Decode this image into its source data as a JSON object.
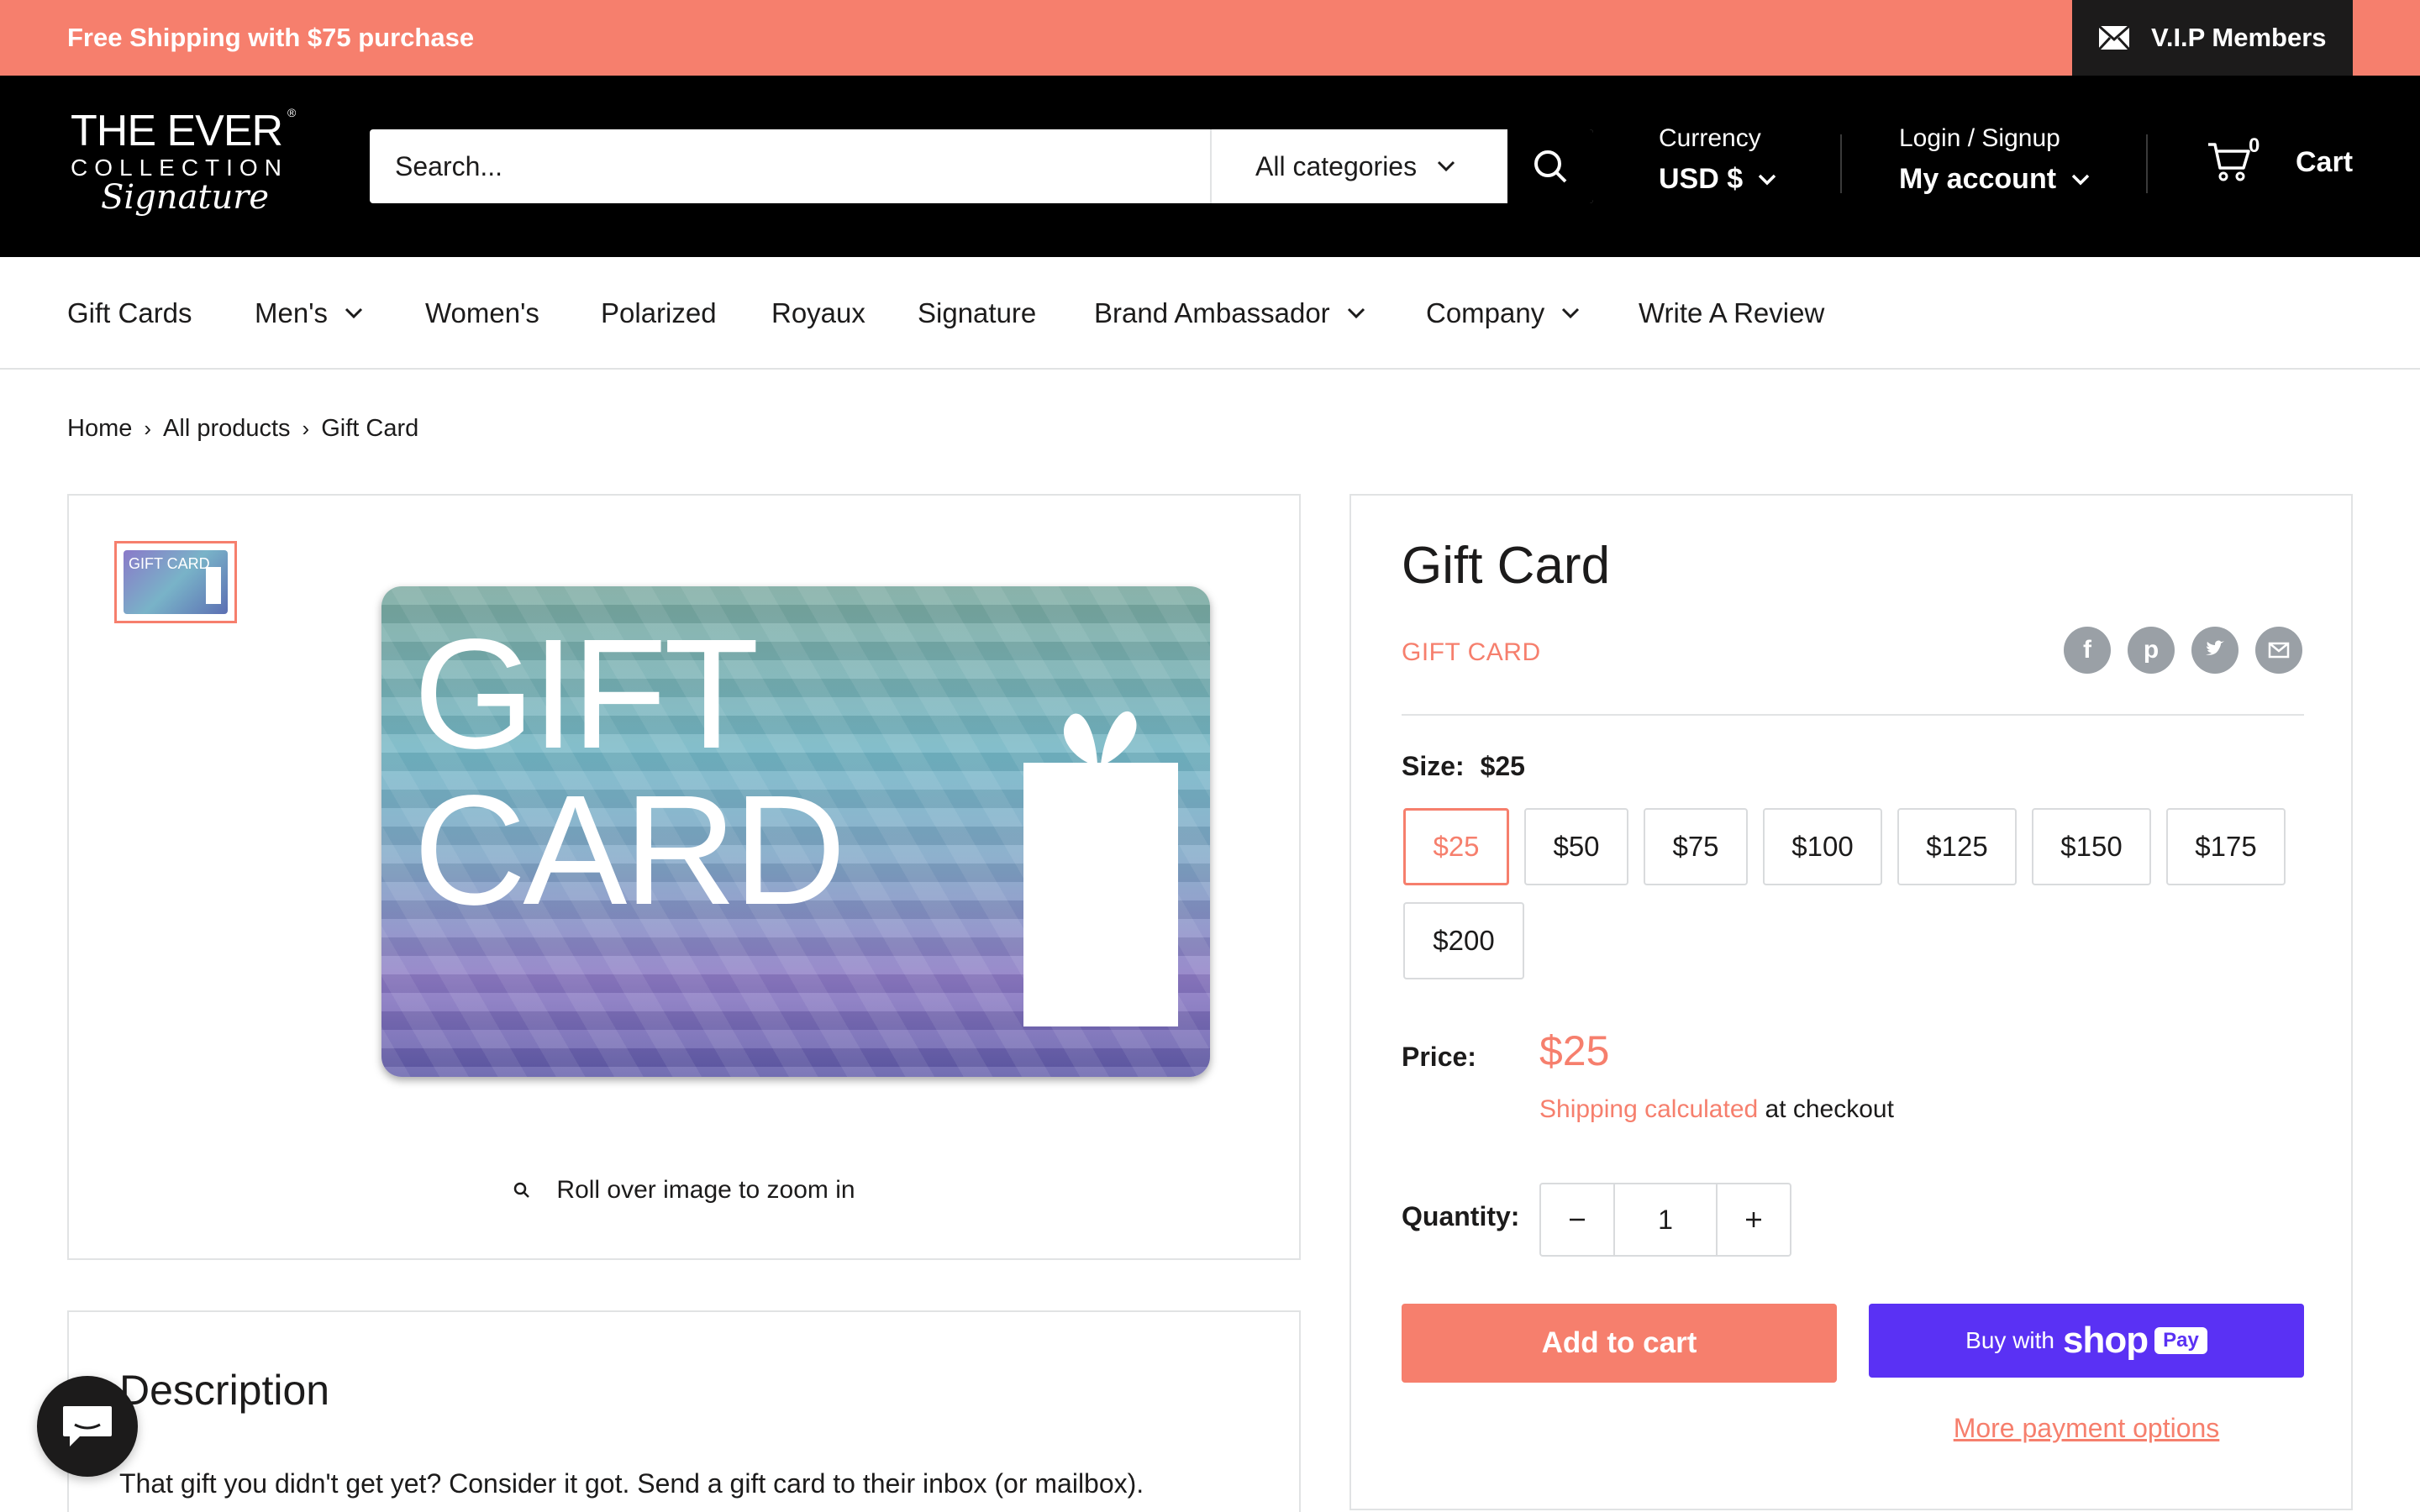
{
  "announcement": {
    "text": "Free Shipping with $75 purchase",
    "vip_label": "V.I.P Members",
    "background": "#f67f6d"
  },
  "header": {
    "logo": {
      "line1": "THE EVER",
      "line2": "COLLECTION",
      "script": "Signature",
      "mark": "®"
    },
    "search": {
      "placeholder": "Search...",
      "category": "All categories"
    },
    "currency": {
      "label": "Currency",
      "value": "USD $"
    },
    "account": {
      "label": "Login / Signup",
      "value": "My account"
    },
    "cart": {
      "count": "0",
      "label": "Cart"
    }
  },
  "nav": {
    "items": [
      {
        "label": "Gift Cards",
        "dropdown": false
      },
      {
        "label": "Men's",
        "dropdown": true
      },
      {
        "label": "Women's",
        "dropdown": false
      },
      {
        "label": "Polarized",
        "dropdown": false
      },
      {
        "label": "Royaux",
        "dropdown": false
      },
      {
        "label": "Signature",
        "dropdown": false
      },
      {
        "label": "Brand Ambassador",
        "dropdown": true
      },
      {
        "label": "Company",
        "dropdown": true
      },
      {
        "label": "Write A Review",
        "dropdown": false
      }
    ]
  },
  "breadcrumb": [
    "Home",
    "All products",
    "Gift Card"
  ],
  "gallery": {
    "thumb_text": "GIFT CARD",
    "image_text_line1": "GIFT",
    "image_text_line2": "CARD",
    "zoom_hint": "Roll over image to zoom in"
  },
  "product": {
    "title": "Gift Card",
    "vendor": "GIFT CARD",
    "share_icons": [
      "facebook-icon",
      "pinterest-icon",
      "twitter-icon",
      "email-icon"
    ],
    "size_label": "Size:",
    "size_value": "$25",
    "sizes": [
      "$25",
      "$50",
      "$75",
      "$100",
      "$125",
      "$150",
      "$175",
      "$200"
    ],
    "selected_size": "$25",
    "price_label": "Price:",
    "price": "$25",
    "shipping_link": "Shipping calculated",
    "shipping_rest": " at checkout",
    "quantity_label": "Quantity:",
    "quantity": "1",
    "add_to_cart": "Add to cart",
    "shop_pay": {
      "prefix": "Buy with",
      "brand": "shop",
      "badge": "Pay"
    },
    "more_payment": "More payment options",
    "accent": "#f67f6d",
    "shop_pay_color": "#5a31f4"
  },
  "description": {
    "title": "Description",
    "text": "That gift you didn't get yet? Consider it got. Send a gift card to their inbox (or mailbox)."
  }
}
